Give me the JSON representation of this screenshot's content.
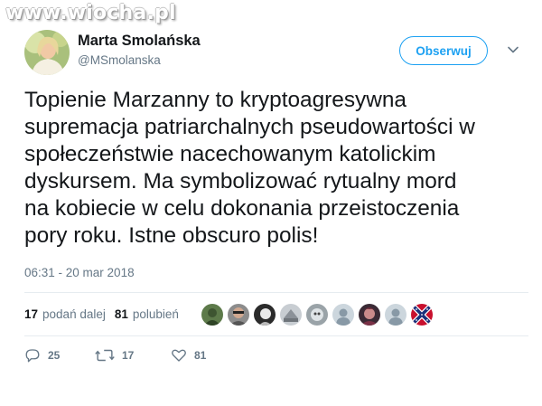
{
  "watermark": "www.wiocha.pl",
  "author": {
    "name": "Marta Smolańska",
    "handle": "@MSmolanska"
  },
  "follow_label": "Obserwuj",
  "tweet": {
    "lines": [
      "Topienie Marzanny to kryptoagresywna",
      "supremacja patriarchalnych pseudowartości w",
      "społeczeństwie nacechowanym katolickim",
      "dyskursem. Ma symbolizować rytualny mord",
      "na kobiecie w celu dokonania przeistoczenia",
      "pory roku. Istne obscuro polis!"
    ],
    "timestamp": "06:31 - 20 mar 2018"
  },
  "stats": {
    "retweets_count": "17",
    "retweets_label": "podań dalej",
    "likes_count": "81",
    "likes_label": "polubień"
  },
  "likers": [
    {
      "icon": "liker-avatar-1-icon"
    },
    {
      "icon": "liker-avatar-2-icon"
    },
    {
      "icon": "liker-avatar-3-icon"
    },
    {
      "icon": "liker-avatar-4-icon"
    },
    {
      "icon": "liker-avatar-5-icon"
    },
    {
      "icon": "default-egg-avatar-icon"
    },
    {
      "icon": "liker-avatar-7-icon"
    },
    {
      "icon": "default-egg-avatar-icon"
    },
    {
      "icon": "flag-avatar-icon"
    }
  ],
  "actions": {
    "reply_count": "25",
    "retweet_count": "17",
    "like_count": "81"
  },
  "colors": {
    "accent": "#1da1f2",
    "text": "#14171a",
    "muted": "#657786",
    "divider": "#e6ecf0"
  }
}
